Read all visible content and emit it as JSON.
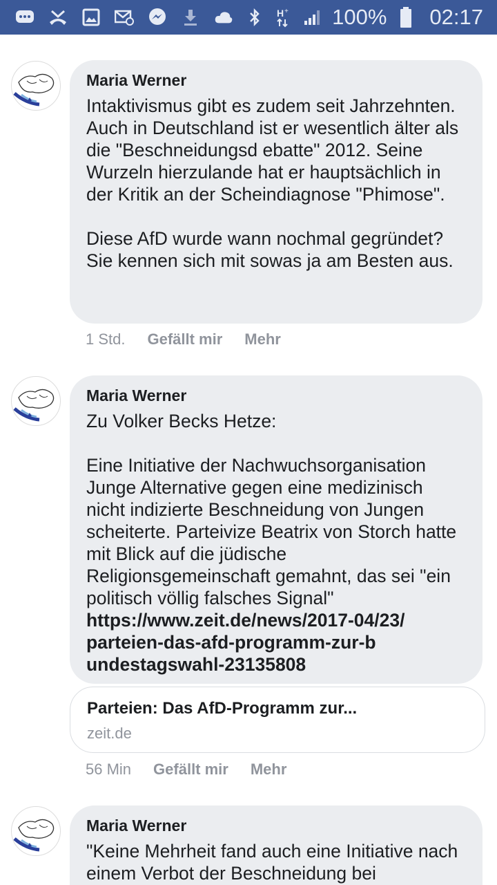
{
  "status_bar": {
    "left_icons": [
      "chat-bubble-icon",
      "missed-call-icon",
      "image-icon",
      "email-icon",
      "messenger-icon",
      "download-icon",
      "cloud-icon"
    ],
    "right_icons": [
      "bluetooth-icon",
      "network-hplus-icon",
      "signal-icon",
      "battery-icon"
    ],
    "battery": "100%",
    "time": "02:17",
    "color": "#3b5998"
  },
  "comments": [
    {
      "author": "Maria Werner",
      "text": "Intaktivismus gibt es zudem seit Jahrzehnten. Auch in Deutschland ist er wesentlich älter als die \"Beschneidungsd ebatte\" 2012. Seine Wurzeln hierzulande hat er hauptsächlich in der Kritik an der Scheindiagnose \"Phimose\".\n\nDiese AfD wurde wann nochmal gegründet? Sie kennen sich mit sowas ja am Besten aus.",
      "time": "1 Std.",
      "like": "Gefällt mir",
      "more": "Mehr"
    },
    {
      "author": "Maria Werner",
      "text": "Zu Volker Becks Hetze:\n\nEine Initiative der Nachwuchsorganisation Junge Alternative gegen eine medizinisch nicht indizierte Beschneidung von Jungen scheiterte. Parteivize Beatrix von Storch hatte mit Blick auf die jüdische Religionsgemeinschaft gemahnt, das sei \"ein politisch völlig falsches Signal\"",
      "link": "https://www.zeit.de/news/2017-04/23/ parteien-das-afd-programm-zur-b undestagswahl-23135808",
      "preview_title": "Parteien: Das AfD-Programm zur...",
      "preview_domain": "zeit.de",
      "time": "56 Min",
      "like": "Gefällt mir",
      "more": "Mehr"
    },
    {
      "author": "Maria Werner",
      "text": "\"Keine Mehrheit fand auch eine Initiative nach einem Verbot der Beschneidung bei"
    }
  ]
}
